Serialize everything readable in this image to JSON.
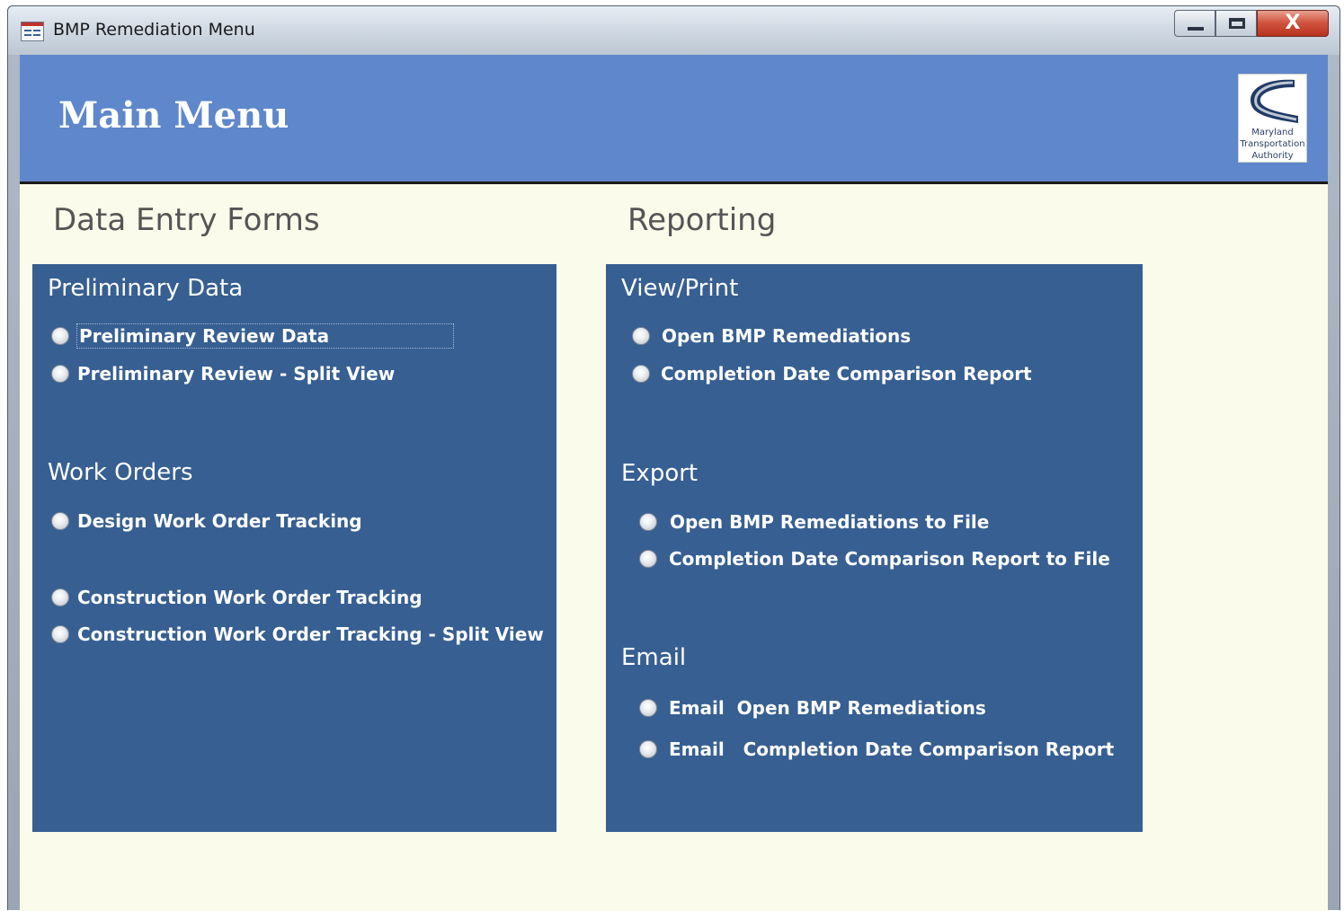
{
  "window": {
    "title": "BMP Remediation Menu",
    "close_glyph": "X"
  },
  "header": {
    "title": "Main Menu",
    "logo_lines": [
      "Maryland",
      "Transportation",
      "Authority"
    ]
  },
  "sections": {
    "data_entry_title": "Data Entry Forms",
    "reporting_title": "Reporting"
  },
  "data_entry": {
    "preliminary": {
      "title": "Preliminary Data",
      "options": [
        "Preliminary Review Data",
        "Preliminary Review - Split View"
      ]
    },
    "work_orders": {
      "title": "Work Orders",
      "options": [
        "Design Work Order Tracking",
        "Construction Work Order Tracking",
        "Construction Work Order Tracking - Split View"
      ]
    }
  },
  "reporting": {
    "view_print": {
      "title": "View/Print",
      "options": [
        "Open BMP Remediations",
        "Completion Date Comparison Report"
      ]
    },
    "export": {
      "title": "Export",
      "options": [
        "Open BMP Remediations to File",
        "Completion Date Comparison Report to File"
      ]
    },
    "email": {
      "title": "Email",
      "options": [
        "Email  Open BMP Remediations",
        "Email   Completion Date Comparison Report"
      ]
    }
  },
  "colors": {
    "header_blue": "#5f87cb",
    "panel_blue": "#375f92",
    "background": "#fafbea"
  },
  "icons": {
    "app": "form-icon",
    "minimize": "minimize-icon",
    "maximize": "maximize-icon",
    "close": "close-icon",
    "logo": "mdta-logo"
  }
}
